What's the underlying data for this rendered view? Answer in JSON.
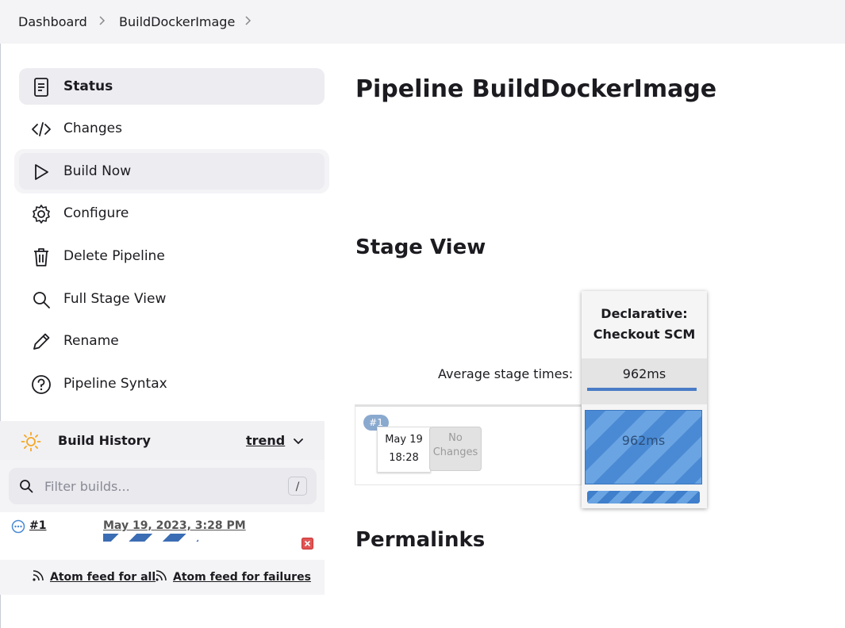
{
  "breadcrumb": {
    "items": [
      "Dashboard",
      "BuildDockerImage"
    ]
  },
  "sidebar": {
    "tasks": [
      {
        "label": "Status",
        "icon": "document-icon"
      },
      {
        "label": "Changes",
        "icon": "code-icon"
      },
      {
        "label": "Build Now",
        "icon": "play-icon"
      },
      {
        "label": "Configure",
        "icon": "gear-icon"
      },
      {
        "label": "Delete Pipeline",
        "icon": "trash-icon"
      },
      {
        "label": "Full Stage View",
        "icon": "search-icon"
      },
      {
        "label": "Rename",
        "icon": "pencil-icon"
      },
      {
        "label": "Pipeline Syntax",
        "icon": "help-icon"
      }
    ]
  },
  "build_history": {
    "title": "Build History",
    "trend_label": "trend",
    "filter_placeholder": "Filter builds...",
    "filter_shortcut": "/",
    "builds": [
      {
        "number": "#1",
        "date": "May 19, 2023, 3:28 PM",
        "status": "in-progress"
      }
    ],
    "feed_all": "Atom feed for all",
    "feed_failures": "Atom feed for failures"
  },
  "main": {
    "title": "Pipeline BuildDockerImage",
    "stage_view_title": "Stage View",
    "permalinks_title": "Permalinks",
    "stage_view": {
      "avg_label": "Average stage times:",
      "stages": [
        {
          "name_line1": "Declarative:",
          "name_line2": "Checkout SCM",
          "avg_time": "962ms"
        }
      ],
      "runs": [
        {
          "badge": "#1",
          "date": "May 19",
          "time": "18:28",
          "changes_line1": "No",
          "changes_line2": "Changes",
          "stage_time": "962ms"
        }
      ]
    }
  },
  "colors": {
    "accent_blue": "#4a8ad4",
    "cancel_red": "#e05555",
    "sun_orange": "#f5a623"
  }
}
